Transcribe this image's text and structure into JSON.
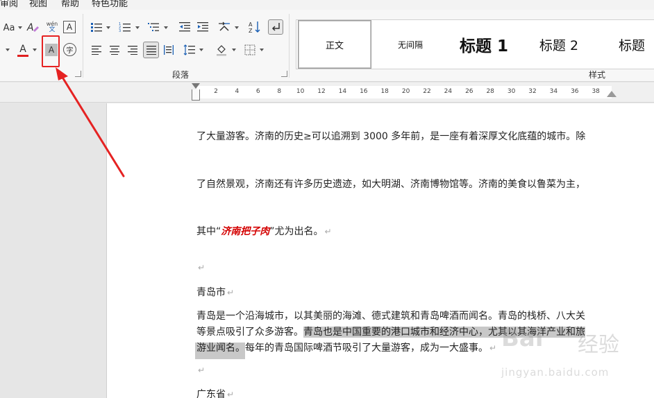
{
  "menu": {
    "items": [
      "审阅",
      "视图",
      "帮助",
      "特色功能"
    ]
  },
  "font_group": {
    "font_size_label": "Aa",
    "phonetic_label": "wén",
    "phonetic_sub": "文",
    "char_border_label": "A",
    "font_color_label": "A",
    "char_shading_label": "A",
    "enclose_char_label": "字"
  },
  "paragraph_group": {
    "label": "段落",
    "sort_label": "A Z"
  },
  "styles_group": {
    "label": "样式",
    "items": [
      "正文",
      "无间隔",
      "标题 1",
      "标题 2",
      "标题"
    ]
  },
  "ruler": {
    "ticks": [
      "2",
      "4",
      "6",
      "8",
      "10",
      "12",
      "14",
      "16",
      "18",
      "20",
      "22",
      "24",
      "26",
      "28",
      "30",
      "32",
      "34",
      "36",
      "38"
    ]
  },
  "document": {
    "line1": "了大量游客。济南的历史≥可以追溯到 3000 多年前，是一座有着深厚文化底蕴的城市。除",
    "line2": "了自然景观，济南还有许多历史遗迹，如大明湖、济南博物馆等。济南的美食以鲁菜为主，",
    "line3_pre": "其中“",
    "line3_emph": "济南把子肉",
    "line3_post": "”尤为出名。",
    "para_mark": "↵",
    "heading_qingdao": "青岛市",
    "qd1": "青岛是一个沿海城市，以其美丽的海滩、德式建筑和青岛啤酒而闻名。青岛的栈桥、八大关",
    "qd2_pre": "等景点吸引了众多游客。",
    "qd2_hl": "青岛也是中国重要的港口城市和经济中心，尤其以其海洋产业和旅",
    "qd3_hl": "游业闻名。",
    "qd3_post": "每年的青岛国际啤酒节吸引了大量游客，成为一大盛事。",
    "heading_guangdong": "广东省"
  },
  "watermark": {
    "logo": "Bai",
    "logo_cn": "经验",
    "url": "jingyan.baidu.com"
  },
  "colors": {
    "annotation_red": "#e52222",
    "highlight_gray": "#c8c8c8",
    "emphasis_red": "#d40000"
  }
}
